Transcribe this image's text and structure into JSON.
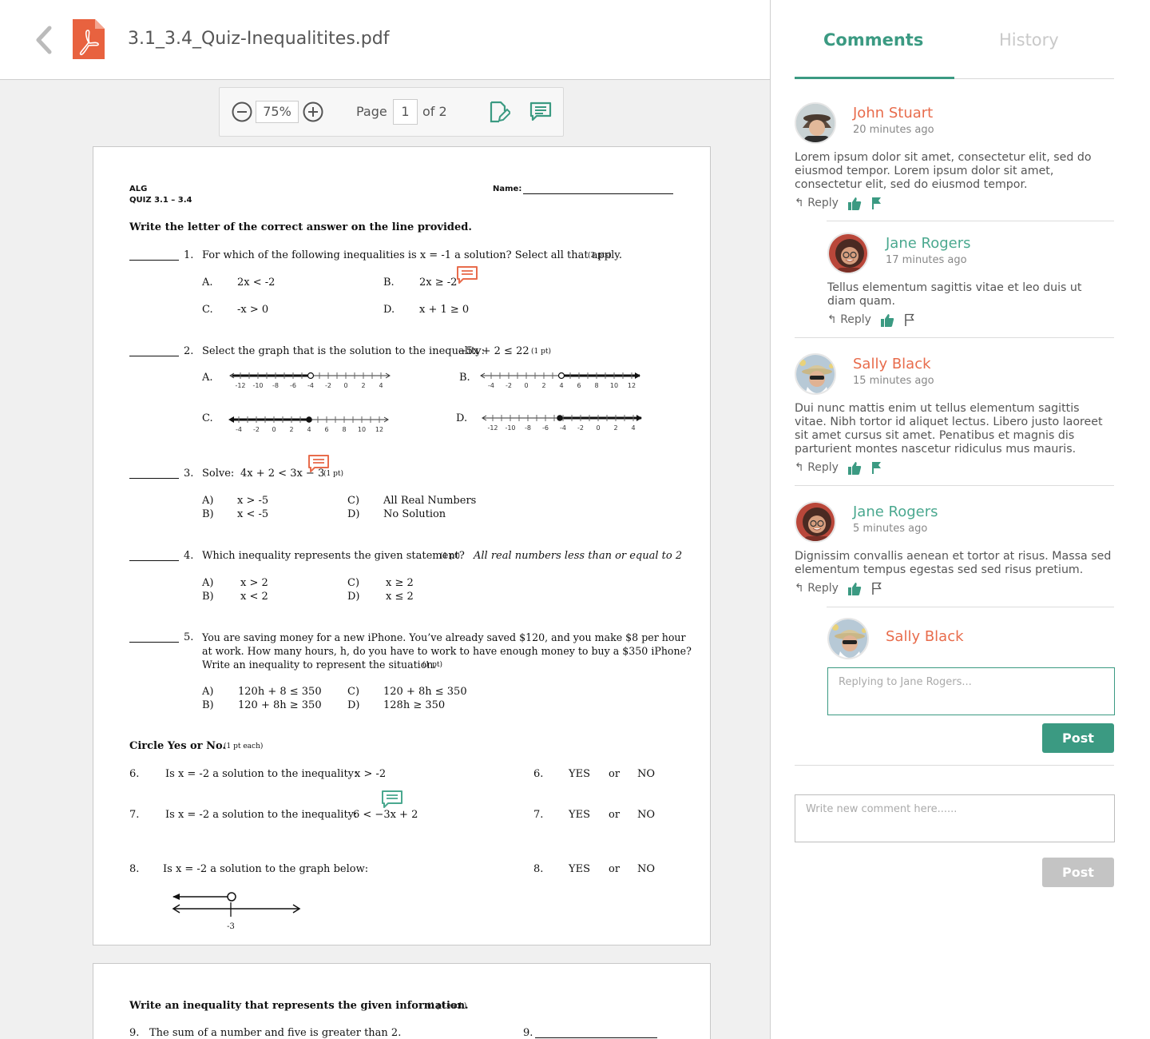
{
  "document": {
    "filename": "3.1_3.4_Quiz-Inequalitites.pdf"
  },
  "toolbar": {
    "zoom": "75%",
    "page_label": "Page",
    "page_current": "1",
    "page_total_label": "of 2"
  },
  "pdf": {
    "course": "ALG",
    "quiz": "QUIZ 3.1 – 3.4",
    "name_label": "Name:",
    "instructions": "Write the letter of the correct answer on the line provided.",
    "q1": {
      "num": "1.",
      "text": "For which of the following inequalities is x = -1 a solution?  Select all that apply.",
      "pts": "(3 pts)",
      "a_label": "A.",
      "a": "2x < -2",
      "b_label": "B.",
      "b": "2x ≥ -2",
      "c_label": "C.",
      "c": "-x  > 0",
      "d_label": "D.",
      "d": "x + 1 ≥ 0"
    },
    "q2": {
      "num": "2.",
      "text": "Select the graph that is the solution to the inequality:",
      "ineq": "−5x + 2 ≤ 22",
      "pts": "(1 pt)",
      "a_label": "A.",
      "b_label": "B.",
      "c_label": "C.",
      "d_label": "D.",
      "ticks_neg": [
        "-12",
        "-10",
        "-8",
        "-6",
        "-4",
        "-2",
        "0",
        "2",
        "4"
      ],
      "ticks_pos": [
        "-4",
        "-2",
        "0",
        "2",
        "4",
        "6",
        "8",
        "10",
        "12"
      ]
    },
    "q3": {
      "num": "3.",
      "text": "Solve:",
      "ineq": "4x + 2 < 3x − 3",
      "pts": "(1 pt)",
      "a_label": "A)",
      "a": "x > -5",
      "b_label": "B)",
      "b": "x < -5",
      "c_label": "C)",
      "c": "All Real Numbers",
      "d_label": "D)",
      "d": "No Solution"
    },
    "q4": {
      "num": "4.",
      "text": "Which inequality represents the given statement?",
      "pts": "(1 pt)",
      "statement": "All real numbers less than or equal to 2",
      "a_label": "A)",
      "a": "x > 2",
      "b_label": "B)",
      "b": "x < 2",
      "c_label": "C)",
      "c": "x ≥ 2",
      "d_label": "D)",
      "d": "x ≤ 2"
    },
    "q5": {
      "num": "5.",
      "line1": "You are saving money for a new iPhone.  You’ve already saved $120, and you make $8 per hour",
      "line2": "at work.  How many hours, h, do you have to work to have enough money to buy a $350 iPhone?",
      "line3": "Write an inequality to represent the situation.",
      "pts": "(1 pt)",
      "a_label": "A)",
      "a": "120h + 8 ≤ 350",
      "b_label": "B)",
      "b": "120 + 8h ≥ 350",
      "c_label": "C)",
      "c": "120 + 8h ≤ 350",
      "d_label": "D)",
      "d": "128h ≥ 350"
    },
    "yn_heading": "Circle Yes or No.",
    "yn_pts": "(1 pt each)",
    "q6": {
      "num": "6.",
      "text": "Is x = -2 a solution to the inequality:",
      "ineq": "x > -2",
      "num2": "6.",
      "yes": "YES",
      "or": "or",
      "no": "NO"
    },
    "q7": {
      "num": "7.",
      "text": "Is x = -2 a solution to the inequality:",
      "ineq": "6 < −3x + 2",
      "num2": "7.",
      "yes": "YES",
      "or": "or",
      "no": "NO"
    },
    "q8": {
      "num": "8.",
      "text": "Is x = -2 a solution to the graph below:",
      "tick": "-3",
      "num2": "8.",
      "yes": "YES",
      "or": "or",
      "no": "NO"
    },
    "page2": {
      "heading": "Write an inequality that represents the given information.",
      "pts": "(1 pt each)",
      "q9_num": "9.",
      "q9_text": "The sum of a number and five is greater than 2.",
      "q9_num2": "9."
    }
  },
  "panel": {
    "tabs": {
      "comments": "Comments",
      "history": "History"
    },
    "reply_label": "Reply",
    "comments": [
      {
        "name": "John Stuart",
        "time": "20 minutes ago",
        "text": "Lorem ipsum dolor sit amet, consectetur elit, sed do eiusmod tempor. Lorem ipsum dolor sit amet, consectetur elit, sed do eiusmod tempor."
      },
      {
        "name": "Jane Rogers",
        "time": "17 minutes ago",
        "text": "Tellus elementum sagittis vitae et leo duis ut diam quam."
      },
      {
        "name": "Sally Black",
        "time": "15 minutes ago",
        "text": "Dui nunc mattis enim ut tellus elementum sagittis vitae. Nibh tortor id aliquet lectus. Libero justo laoreet sit amet cursus sit amet. Penatibus et magnis dis parturient montes nascetur ridiculus mus mauris."
      },
      {
        "name": "Jane Rogers",
        "time": "5 minutes ago",
        "text": "Dignissim convallis aenean et tortor at risus. Massa sed elementum tempus egestas sed sed risus pretium."
      }
    ],
    "reply_box": {
      "name": "Sally Black",
      "placeholder": "Replying to Jane Rogers...",
      "post": "Post"
    },
    "new_comment": {
      "placeholder": "Write new comment here......",
      "post": "Post"
    },
    "colors": {
      "accent": "#3b9a82",
      "orange": "#e86c4c",
      "green_name": "#4aa88f",
      "disabled": "#c4c4c4"
    }
  }
}
